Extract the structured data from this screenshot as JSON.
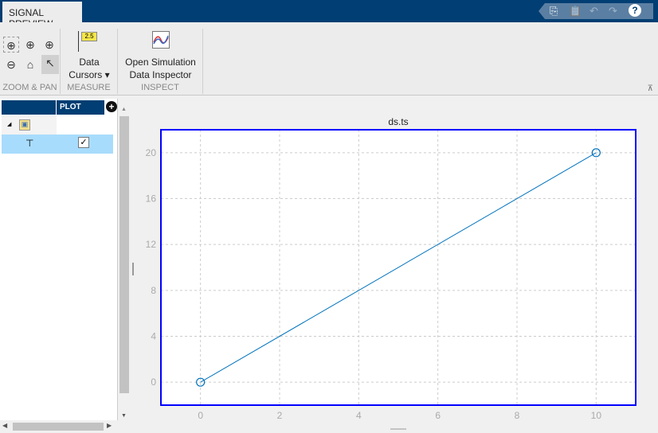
{
  "tab": {
    "label": "SIGNAL PREVIEW"
  },
  "quick_access": [
    "copy-icon",
    "paste-icon",
    "undo-icon",
    "redo-icon",
    "help-icon"
  ],
  "ribbon": {
    "zoom_pan": {
      "label": "ZOOM & PAN"
    },
    "measure": {
      "label": "MEASURE",
      "data_cursors_line1": "Data",
      "data_cursors_line2": "Cursors",
      "badge": "2.5"
    },
    "inspect": {
      "label": "INSPECT",
      "sdi_line1": "Open Simulation",
      "sdi_line2": "Data Inspector"
    }
  },
  "tree": {
    "plot_header": "PLOT",
    "checked": true
  },
  "chart_data": {
    "type": "line",
    "title": "ds.ts",
    "x": [
      0,
      10
    ],
    "y": [
      0,
      20
    ],
    "xlim": [
      -1,
      11
    ],
    "ylim": [
      -2,
      22
    ],
    "xticks": [
      0,
      2,
      4,
      6,
      8,
      10
    ],
    "yticks": [
      0,
      4,
      8,
      12,
      16,
      20
    ],
    "grid": true,
    "marker": "circle",
    "color": "#0072bd",
    "box_color": "#0000ff"
  }
}
